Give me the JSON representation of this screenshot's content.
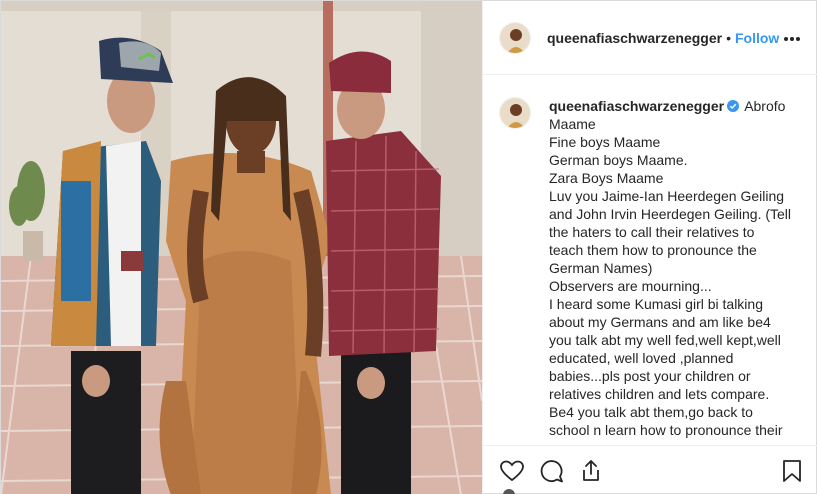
{
  "post": {
    "username": "queenafiaschwarzenegger",
    "separator": "•",
    "follow_label": "Follow",
    "more_icon": "more-horizontal-icon",
    "verified_icon": "verified-badge-icon"
  },
  "caption": {
    "username": "queenafiaschwarzenegger",
    "first_line": "Abrofo",
    "lines": [
      "Maame",
      "Fine boys Maame",
      "German boys Maame.",
      "Zara Boys Maame",
      "Luv you Jaime-Ian Heerdegen Geiling",
      "and John Irvin Heerdegen Geiling. (Tell",
      "the haters to call their relatives to",
      "teach them how to pronounce the",
      "German Names)",
      "Observers are mourning...",
      "I heard some Kumasi girl bi talking",
      "about my Germans and am like be4",
      "you talk abt my well fed,well kept,well",
      "educated, well loved ,planned",
      "babies...pls post your children or",
      "relatives children and lets compare.",
      "Be4 you talk abt them,go back to",
      "school n learn how to pronounce their"
    ]
  },
  "actions": {
    "like_icon": "heart-icon",
    "comment_icon": "comment-icon",
    "share_icon": "share-icon",
    "save_icon": "bookmark-icon"
  },
  "colors": {
    "follow": "#3897f0",
    "verified": "#3897f0",
    "text": "#262626",
    "border": "#dbdbdb"
  }
}
